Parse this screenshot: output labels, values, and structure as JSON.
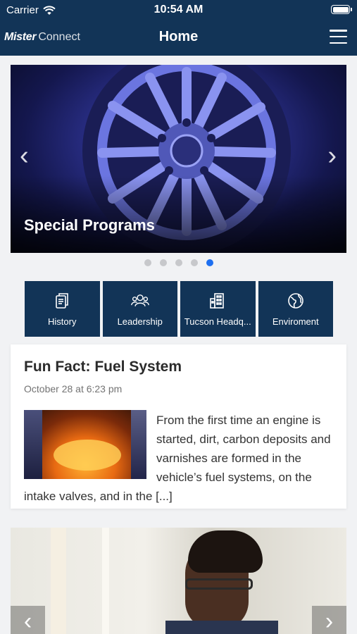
{
  "status_bar": {
    "carrier": "Carrier",
    "time": "10:54 AM"
  },
  "nav": {
    "brand_bold": "Mister",
    "brand_light": "Connect",
    "title": "Home"
  },
  "carousel": {
    "caption": "Special Programs",
    "slide_count": 5,
    "active_slide": 5
  },
  "tiles": [
    {
      "label": "History",
      "icon": "document-icon"
    },
    {
      "label": "Leadership",
      "icon": "people-icon"
    },
    {
      "label": "Tucson Headq...",
      "icon": "building-icon"
    },
    {
      "label": "Enviroment",
      "icon": "globe-icon"
    }
  ],
  "post": {
    "title": "Fun Fact: Fuel System",
    "date": "October 28 at 6:23 pm",
    "excerpt": "From the first time an engine is started, dirt, carbon deposits and varnishes are formed in the vehicle’s fuel systems, on the intake valves, and in the [...]"
  },
  "colors": {
    "header": "#123457",
    "tile": "#123457",
    "active_dot": "#1e6ff0"
  }
}
